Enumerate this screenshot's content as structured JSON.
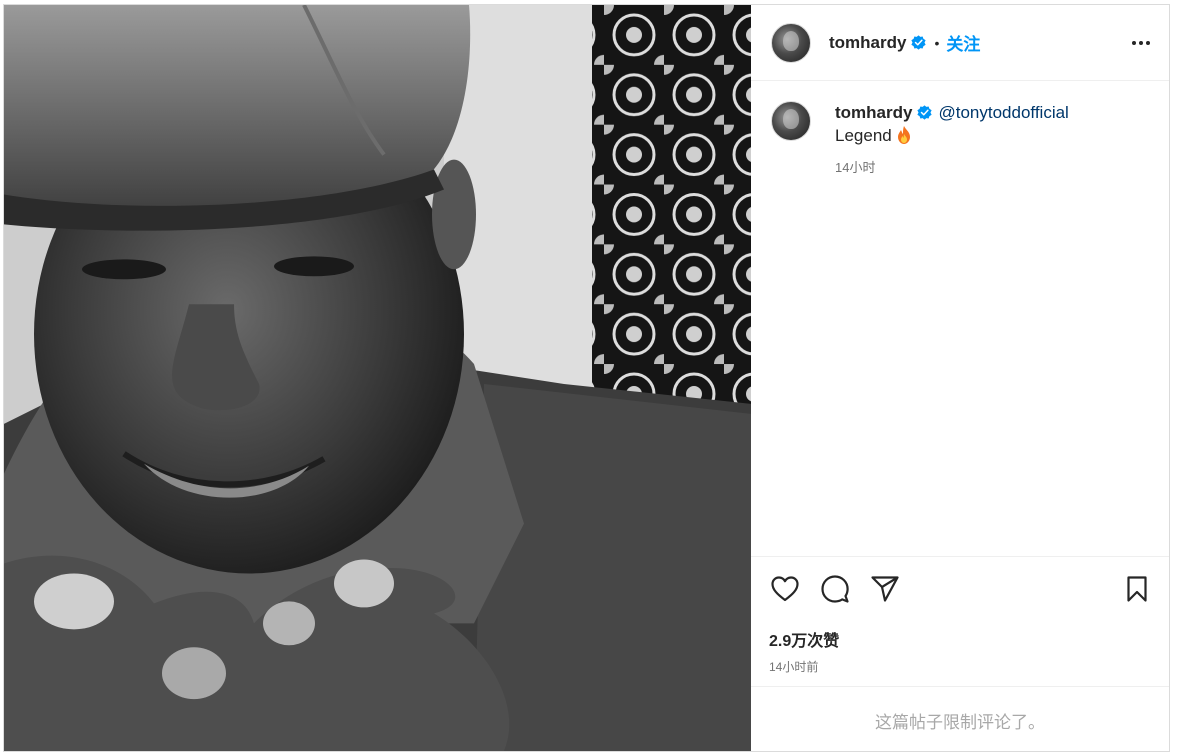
{
  "header": {
    "username": "tomhardy",
    "separator": "•",
    "follow_label": "关注"
  },
  "caption": {
    "username": "tomhardy",
    "mention": "@tonytoddofficial",
    "text": "Legend",
    "time": "14小时"
  },
  "engagement": {
    "likes": "2.9万次赞",
    "post_time": "14小时前"
  },
  "footer": {
    "comments_limited": "这篇帖子限制评论了。"
  },
  "icons": {
    "verified": "verified-badge-icon",
    "more": "more-options-icon",
    "like": "heart-icon",
    "comment": "comment-icon",
    "share": "share-icon",
    "save": "bookmark-icon",
    "emoji": "fire-emoji-icon"
  },
  "colors": {
    "accent": "#0095f6",
    "mention": "#00376b",
    "secondary_text": "#737373",
    "muted_text": "#a8a8a8"
  }
}
